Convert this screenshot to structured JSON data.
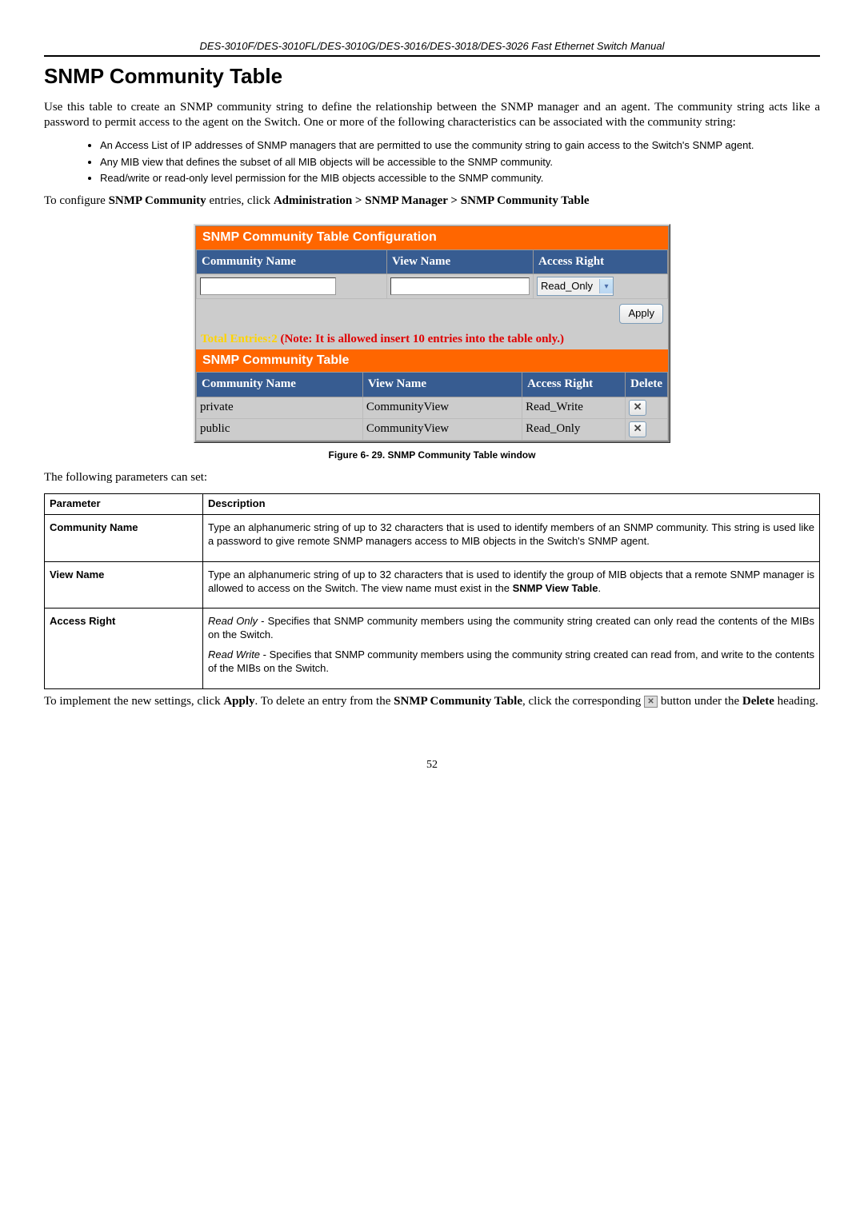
{
  "header": "DES-3010F/DES-3010FL/DES-3010G/DES-3016/DES-3018/DES-3026 Fast Ethernet Switch Manual",
  "title": "SNMP Community Table",
  "intro": "Use this table to create an SNMP community string to define the relationship between the SNMP manager and an agent. The community string acts like a password to permit access to the agent on the Switch. One or more of the following characteristics can be associated with the community string:",
  "bullets": [
    "An Access List of IP addresses of SNMP managers that are permitted to use the community string to gain access to the Switch's SNMP agent.",
    "Any MIB view that defines the subset of all MIB objects will be accessible to the SNMP community.",
    "Read/write or read-only level permission for the MIB objects accessible to the SNMP community."
  ],
  "nav_text_prefix": "To configure ",
  "nav_bold1": "SNMP Community",
  "nav_mid": " entries, click ",
  "nav_bold2": "Administration > SNMP Manager > SNMP Community Table",
  "widget": {
    "cfg_title": "SNMP Community Table Configuration",
    "cols": {
      "c1": "Community Name",
      "c2": "View Name",
      "c3": "Access Right"
    },
    "access_value": "Read_Only",
    "apply": "Apply",
    "note_yellow": "Total Entries:2 ",
    "note_red": "(Note: It is allowed insert 10 entries into the table only.)",
    "tbl_title": "SNMP Community Table",
    "tbl_cols": {
      "c1": "Community Name",
      "c2": "View Name",
      "c3": "Access Right",
      "c4": "Delete"
    },
    "rows": [
      {
        "name": "private",
        "view": "CommunityView",
        "access": "Read_Write"
      },
      {
        "name": "public",
        "view": "CommunityView",
        "access": "Read_Only"
      }
    ]
  },
  "figure_caption": "Figure 6- 29. SNMP Community Table window",
  "following_text": "The following parameters can set:",
  "params_header": {
    "p": "Parameter",
    "d": "Description"
  },
  "params": {
    "cn": {
      "label": "Community Name",
      "desc": "Type an alphanumeric string of up to 32 characters that is used to identify members of an SNMP community. This string is used like a password to give remote SNMP managers access to MIB objects in the Switch's SNMP agent."
    },
    "vn": {
      "label": "View Name",
      "desc_pre": "Type an alphanumeric string of up to 32 characters that is used to identify the group of MIB objects that a remote SNMP manager is allowed to access on the Switch. The view name must exist in the ",
      "desc_bold": "SNMP View Table",
      "desc_post": "."
    },
    "ar": {
      "label": "Access Right",
      "ro_i": "Read Only",
      "ro_t": " - Specifies that SNMP community members using the community string created can only read the contents of the MIBs on the Switch.",
      "rw_i": "Read Write",
      "rw_t": " - Specifies that SNMP community members using the community string created can read from, and write to the contents of the MIBs on the Switch."
    }
  },
  "impl_1": "To implement the new settings, click ",
  "impl_apply": "Apply",
  "impl_2": ". To delete an entry from the ",
  "impl_bold": "SNMP Community Table",
  "impl_3": ", click the corresponding ",
  "impl_4": " button under the ",
  "impl_delete": "Delete",
  "impl_5": " heading.",
  "page_num": "52"
}
